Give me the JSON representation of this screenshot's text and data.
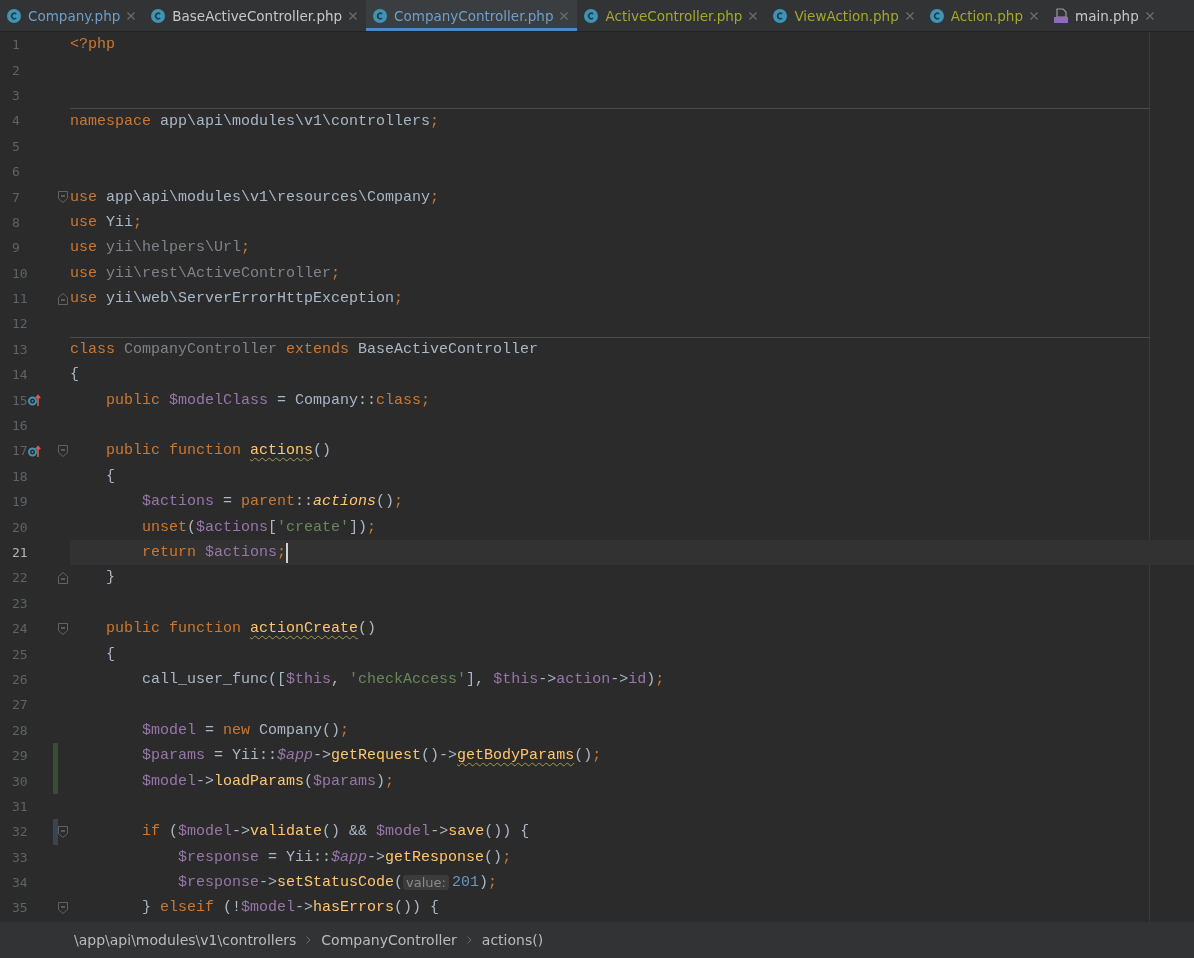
{
  "tabs": [
    {
      "label": "Company.php",
      "kind": "class",
      "color": "#6f9fc9",
      "selected": false
    },
    {
      "label": "BaseActiveController.php",
      "kind": "class",
      "color": "#c8c8c8",
      "selected": false
    },
    {
      "label": "CompanyController.php",
      "kind": "class",
      "color": "#6f9fc9",
      "selected": true
    },
    {
      "label": "ActiveController.php",
      "kind": "class",
      "color": "#a5a82c",
      "selected": false
    },
    {
      "label": "ViewAction.php",
      "kind": "class",
      "color": "#a5a82c",
      "selected": false
    },
    {
      "label": "Action.php",
      "kind": "class",
      "color": "#a5a82c",
      "selected": false
    },
    {
      "label": "main.php",
      "kind": "php",
      "color": "#c8c8c8",
      "selected": false
    }
  ],
  "editor": {
    "lines": [
      {
        "number": "1",
        "tokens": [
          {
            "kind": "keyword",
            "text": "<?php"
          }
        ]
      },
      {
        "number": "2"
      },
      {
        "number": "3"
      },
      {
        "number": "4",
        "separator_above": true,
        "tokens": [
          {
            "kind": "keyword",
            "text": "namespace"
          },
          {
            "kind": "plain",
            "text": " app\\api\\modules\\v1\\controllers"
          },
          {
            "kind": "keyword",
            "text": ";"
          }
        ]
      },
      {
        "number": "5"
      },
      {
        "number": "6"
      },
      {
        "number": "7",
        "fold_start": true,
        "tokens": [
          {
            "kind": "keyword",
            "text": "use"
          },
          {
            "kind": "plain",
            "text": " app\\api\\modules\\v1\\resources\\Company"
          },
          {
            "kind": "keyword",
            "text": ";"
          }
        ]
      },
      {
        "number": "8",
        "tokens": [
          {
            "kind": "keyword",
            "text": "use"
          },
          {
            "kind": "plain",
            "text": " Yii"
          },
          {
            "kind": "keyword",
            "text": ";"
          }
        ]
      },
      {
        "number": "9",
        "tokens": [
          {
            "kind": "keyword",
            "text": "use"
          },
          {
            "kind": "dim",
            "text": " yii\\helpers\\Url"
          },
          {
            "kind": "keyword",
            "text": ";"
          }
        ]
      },
      {
        "number": "10",
        "tokens": [
          {
            "kind": "keyword",
            "text": "use"
          },
          {
            "kind": "dim",
            "text": " yii\\rest\\ActiveController"
          },
          {
            "kind": "keyword",
            "text": ";"
          }
        ]
      },
      {
        "number": "11",
        "fold_end": true,
        "tokens": [
          {
            "kind": "keyword",
            "text": "use"
          },
          {
            "kind": "plain",
            "text": " yii\\web\\ServerErrorHttpException"
          },
          {
            "kind": "keyword",
            "text": ";"
          }
        ]
      },
      {
        "number": "12"
      },
      {
        "number": "13",
        "separator_above": true,
        "tokens": [
          {
            "kind": "keyword",
            "text": "class"
          },
          {
            "kind": "dim",
            "text": " CompanyController"
          },
          {
            "kind": "keyword",
            "text": " extends"
          },
          {
            "kind": "plain",
            "text": " BaseActiveController"
          }
        ]
      },
      {
        "number": "14",
        "tokens": [
          {
            "kind": "plain",
            "text": "{"
          }
        ]
      },
      {
        "number": "15",
        "overrides": true,
        "tokens": [
          {
            "kind": "keyword",
            "text": "    public"
          },
          {
            "kind": "variable",
            "text": " $modelClass"
          },
          {
            "kind": "plain",
            "text": " = Company::"
          },
          {
            "kind": "keyword",
            "text": "class;"
          }
        ]
      },
      {
        "number": "16"
      },
      {
        "number": "17",
        "overrides": true,
        "fold_start": true,
        "tokens": [
          {
            "kind": "keyword",
            "text": "    public function "
          },
          {
            "kind": "function",
            "text": "actions",
            "wavy": true
          },
          {
            "kind": "plain",
            "text": "()"
          }
        ]
      },
      {
        "number": "18",
        "tokens": [
          {
            "kind": "plain",
            "text": "    {"
          }
        ]
      },
      {
        "number": "19",
        "tokens": [
          {
            "kind": "variable",
            "text": "        $actions"
          },
          {
            "kind": "plain",
            "text": " = "
          },
          {
            "kind": "keyword",
            "text": "parent"
          },
          {
            "kind": "plain",
            "text": "::"
          },
          {
            "kind": "function",
            "text": "actions",
            "italic": true
          },
          {
            "kind": "plain",
            "text": "()"
          },
          {
            "kind": "keyword",
            "text": ";"
          }
        ]
      },
      {
        "number": "20",
        "tokens": [
          {
            "kind": "keyword",
            "text": "        unset"
          },
          {
            "kind": "plain",
            "text": "("
          },
          {
            "kind": "variable",
            "text": "$actions"
          },
          {
            "kind": "plain",
            "text": "["
          },
          {
            "kind": "string",
            "text": "'create'"
          },
          {
            "kind": "plain",
            "text": "])"
          },
          {
            "kind": "keyword",
            "text": ";"
          }
        ]
      },
      {
        "number": "21",
        "current": true,
        "tokens": [
          {
            "kind": "keyword",
            "text": "        return "
          },
          {
            "kind": "variable",
            "text": "$actions"
          },
          {
            "kind": "keyword",
            "text": ";"
          }
        ]
      },
      {
        "number": "22",
        "fold_end": true,
        "tokens": [
          {
            "kind": "plain",
            "text": "    }"
          }
        ]
      },
      {
        "number": "23"
      },
      {
        "number": "24",
        "fold_start": true,
        "tokens": [
          {
            "kind": "keyword",
            "text": "    public function "
          },
          {
            "kind": "function",
            "text": "actionCreate",
            "wavy": true
          },
          {
            "kind": "plain",
            "text": "()"
          }
        ]
      },
      {
        "number": "25",
        "tokens": [
          {
            "kind": "plain",
            "text": "    {"
          }
        ]
      },
      {
        "number": "26",
        "tokens": [
          {
            "kind": "plain",
            "text": "        call_user_func(["
          },
          {
            "kind": "variable",
            "text": "$this"
          },
          {
            "kind": "plain",
            "text": ", "
          },
          {
            "kind": "string",
            "text": "'checkAccess'"
          },
          {
            "kind": "plain",
            "text": "], "
          },
          {
            "kind": "variable",
            "text": "$this"
          },
          {
            "kind": "plain",
            "text": "->"
          },
          {
            "kind": "variable",
            "text": "action"
          },
          {
            "kind": "plain",
            "text": "->"
          },
          {
            "kind": "variable",
            "text": "id"
          },
          {
            "kind": "plain",
            "text": ")"
          },
          {
            "kind": "keyword",
            "text": ";"
          }
        ]
      },
      {
        "number": "27"
      },
      {
        "number": "28",
        "tokens": [
          {
            "kind": "variable",
            "text": "        $model"
          },
          {
            "kind": "plain",
            "text": " = "
          },
          {
            "kind": "keyword",
            "text": "new "
          },
          {
            "kind": "plain",
            "text": "Company()"
          },
          {
            "kind": "keyword",
            "text": ";"
          }
        ]
      },
      {
        "number": "29",
        "added": true,
        "tokens": [
          {
            "kind": "variable",
            "text": "        $params"
          },
          {
            "kind": "plain",
            "text": " = Yii::"
          },
          {
            "kind": "variable",
            "text": "$app",
            "italic": true
          },
          {
            "kind": "plain",
            "text": "->"
          },
          {
            "kind": "function",
            "text": "getRequest"
          },
          {
            "kind": "plain",
            "text": "()->"
          },
          {
            "kind": "function",
            "text": "getBodyParams",
            "wavy": true
          },
          {
            "kind": "plain",
            "text": "()"
          },
          {
            "kind": "keyword",
            "text": ";"
          }
        ]
      },
      {
        "number": "30",
        "added": true,
        "tokens": [
          {
            "kind": "variable",
            "text": "        $model"
          },
          {
            "kind": "plain",
            "text": "->"
          },
          {
            "kind": "function",
            "text": "loadParams"
          },
          {
            "kind": "plain",
            "text": "("
          },
          {
            "kind": "variable",
            "text": "$params"
          },
          {
            "kind": "plain",
            "text": ")"
          },
          {
            "kind": "keyword",
            "text": ";"
          }
        ]
      },
      {
        "number": "31"
      },
      {
        "number": "32",
        "modified": true,
        "fold_start": true,
        "tokens": [
          {
            "kind": "keyword",
            "text": "        if "
          },
          {
            "kind": "plain",
            "text": "("
          },
          {
            "kind": "variable",
            "text": "$model"
          },
          {
            "kind": "plain",
            "text": "->"
          },
          {
            "kind": "function",
            "text": "validate"
          },
          {
            "kind": "plain",
            "text": "() && "
          },
          {
            "kind": "variable",
            "text": "$model"
          },
          {
            "kind": "plain",
            "text": "->"
          },
          {
            "kind": "function",
            "text": "save"
          },
          {
            "kind": "plain",
            "text": "()) {"
          }
        ]
      },
      {
        "number": "33",
        "tokens": [
          {
            "kind": "variable",
            "text": "            $response"
          },
          {
            "kind": "plain",
            "text": " = Yii::"
          },
          {
            "kind": "variable",
            "text": "$app",
            "italic": true
          },
          {
            "kind": "plain",
            "text": "->"
          },
          {
            "kind": "function",
            "text": "getResponse"
          },
          {
            "kind": "plain",
            "text": "()"
          },
          {
            "kind": "keyword",
            "text": ";"
          }
        ]
      },
      {
        "number": "34",
        "tokens": [
          {
            "kind": "variable",
            "text": "            $response"
          },
          {
            "kind": "plain",
            "text": "->"
          },
          {
            "kind": "function",
            "text": "setStatusCode"
          },
          {
            "kind": "plain",
            "text": "("
          },
          {
            "kind": "hint",
            "text": "value:"
          },
          {
            "kind": "number",
            "text": "201"
          },
          {
            "kind": "plain",
            "text": ")"
          },
          {
            "kind": "keyword",
            "text": ";"
          }
        ]
      },
      {
        "number": "35",
        "fold_start": true,
        "tokens": [
          {
            "kind": "plain",
            "text": "        } "
          },
          {
            "kind": "keyword",
            "text": "elseif "
          },
          {
            "kind": "plain",
            "text": "(!"
          },
          {
            "kind": "variable",
            "text": "$model"
          },
          {
            "kind": "plain",
            "text": "->"
          },
          {
            "kind": "function",
            "text": "hasErrors"
          },
          {
            "kind": "plain",
            "text": "()) {"
          }
        ]
      }
    ]
  },
  "breadcrumbs": [
    "\\app\\api\\modules\\v1\\controllers",
    "CompanyController",
    "actions()"
  ]
}
